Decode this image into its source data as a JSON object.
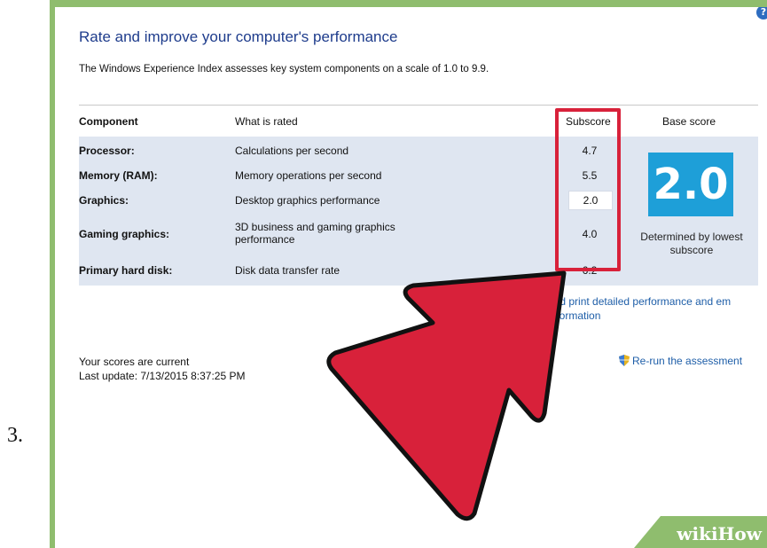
{
  "step": {
    "number": "3."
  },
  "page": {
    "title": "Rate and improve your computer's performance",
    "description": "The Windows Experience Index assesses key system components on a scale of 1.0 to 9.9."
  },
  "table": {
    "headers": {
      "component": "Component",
      "what_is_rated": "What is rated",
      "subscore": "Subscore",
      "base_score": "Base score"
    },
    "rows": [
      {
        "component": "Processor:",
        "what_is_rated": "Calculations per second",
        "subscore": "4.7"
      },
      {
        "component": "Memory (RAM):",
        "what_is_rated": "Memory operations per second",
        "subscore": "5.5"
      },
      {
        "component": "Graphics:",
        "what_is_rated": "Desktop graphics performance",
        "subscore": "2.0"
      },
      {
        "component": "Gaming graphics:",
        "what_is_rated": "3D business and gaming graphics performance",
        "subscore": "4.0"
      },
      {
        "component": "Primary hard disk:",
        "what_is_rated": "Disk data transfer rate",
        "subscore": "6.2"
      }
    ],
    "base_score": {
      "value": "2.0",
      "caption": "Determined by lowest subscore"
    }
  },
  "links": {
    "detail": "and print detailed performance and em information",
    "rerun": "Re-run the assessment"
  },
  "status": {
    "current": "Your scores are current",
    "last_update": "Last update: 7/13/2015 8:37:25 PM"
  },
  "watermark": {
    "text": "wikiHow"
  },
  "colors": {
    "frame": "#8fbd6e",
    "arrow": "#d8213a",
    "tile": "#1e9fd8",
    "title": "#1e3c8c",
    "link": "#1e5ea8"
  },
  "icons": {
    "help": "help-icon",
    "shield": "shield-icon",
    "arrow": "pointer-arrow-icon"
  }
}
